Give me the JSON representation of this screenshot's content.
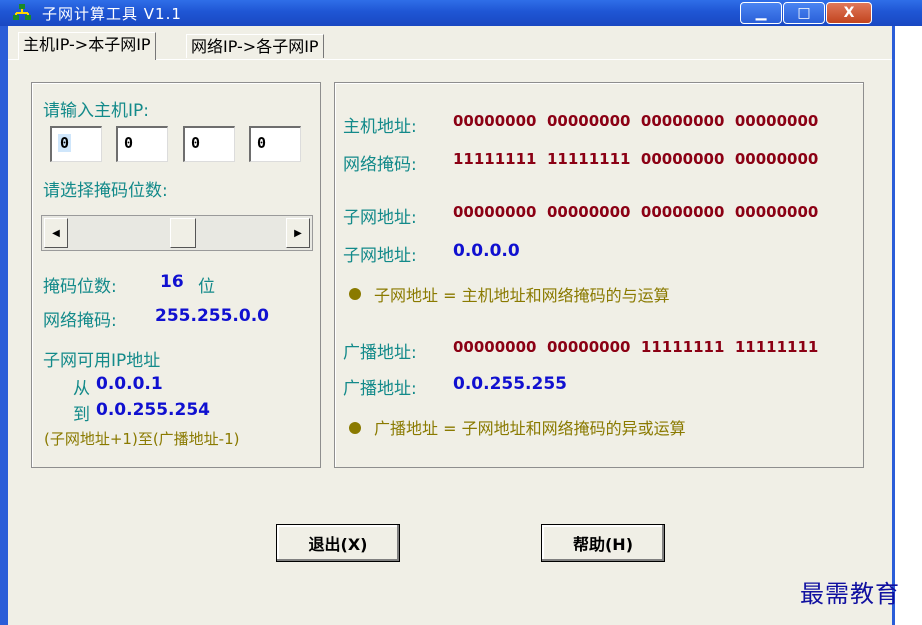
{
  "window": {
    "title": "子网计算工具  V1.1",
    "minimize": "▁",
    "maximize": "□",
    "close": "X"
  },
  "tabs": [
    {
      "label": "主机IP->本子网IP"
    },
    {
      "label": "网络IP->各子网IP"
    }
  ],
  "left": {
    "input_label": "请输入主机IP:",
    "ip": [
      "0",
      "0",
      "0",
      "0"
    ],
    "mask_select_label": "请选择掩码位数:",
    "slider_left": "◀",
    "slider_right": "▶",
    "mask_bits_label": "掩码位数:",
    "mask_bits_value": "16",
    "mask_bits_unit": "位",
    "netmask_label": "网络掩码:",
    "netmask_value": "255.255.0.0",
    "usable_title": "子网可用IP地址",
    "from_label": "从",
    "from_value": "0.0.0.1",
    "to_label": "到",
    "to_value": "0.0.255.254",
    "range_note": "(子网地址+1)至(广播地址-1)"
  },
  "right": {
    "host_addr_label": "主机地址:",
    "host_addr_bin": "00000000  00000000  00000000  00000000",
    "netmask_label": "网络掩码:",
    "netmask_bin": "11111111  11111111  00000000  00000000",
    "subnet_label": "子网地址:",
    "subnet_bin": "00000000  00000000  00000000  00000000",
    "subnet_label2": "子网地址:",
    "subnet_dec": "0.0.0.0",
    "subnet_note": "子网地址 = 主机地址和网络掩码的与运算",
    "broadcast_label": "广播地址:",
    "broadcast_bin": "00000000  00000000  11111111  11111111",
    "broadcast_label2": "广播地址:",
    "broadcast_dec": "0.0.255.255",
    "broadcast_note": "广播地址 = 子网地址和网络掩码的异或运算"
  },
  "buttons": {
    "exit": "退出(X)",
    "help": "帮助(H)"
  },
  "watermark": "最需教育"
}
